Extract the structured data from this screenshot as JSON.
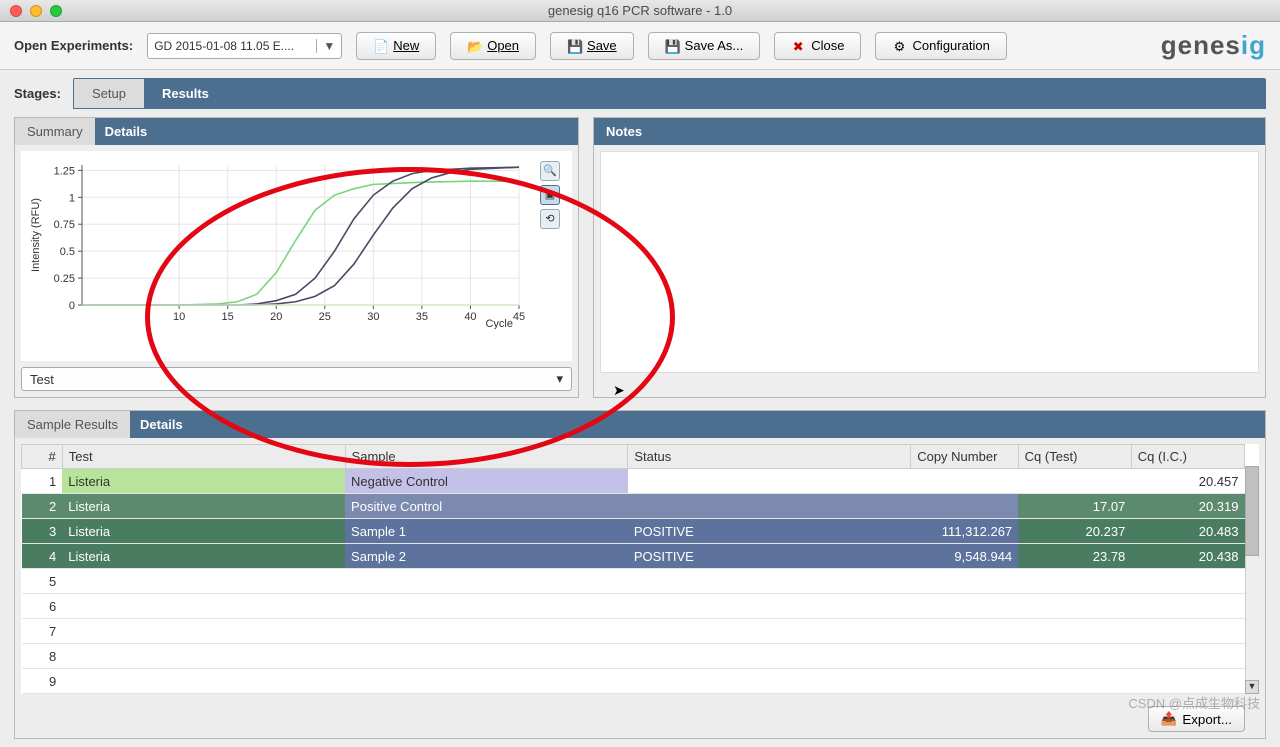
{
  "window": {
    "title": "genesig q16 PCR software - 1.0"
  },
  "toolbar": {
    "open_experiments_label": "Open Experiments:",
    "experiment_selected": "GD 2015-01-08 11.05 E....",
    "new_label": "New",
    "open_label": "Open",
    "save_label": "Save",
    "save_as_label": "Save As...",
    "close_label": "Close",
    "configuration_label": "Configuration",
    "logo_part1": "genes",
    "logo_part2": "ig"
  },
  "stages": {
    "label": "Stages:",
    "setup_tab": "Setup",
    "results_tab": "Results"
  },
  "chart_panel": {
    "summary_tab": "Summary",
    "details_tab": "Details",
    "test_select": "Test"
  },
  "notes_panel": {
    "title": "Notes"
  },
  "chart_data": {
    "type": "line",
    "title": "",
    "xlabel": "Cycle",
    "ylabel": "Intensity (RFU)",
    "xlim": [
      0,
      45
    ],
    "ylim": [
      0,
      1.3
    ],
    "xticks": [
      10,
      15,
      20,
      25,
      30,
      35,
      40,
      45
    ],
    "yticks": [
      0,
      0.25,
      0.5,
      0.75,
      1,
      1.25
    ],
    "series": [
      {
        "name": "Positive Control",
        "color": "#7bd47b",
        "x": [
          0,
          5,
          10,
          14,
          16,
          18,
          20,
          22,
          24,
          26,
          28,
          30,
          35,
          40,
          45
        ],
        "y": [
          0,
          0,
          0,
          0.01,
          0.03,
          0.1,
          0.3,
          0.6,
          0.88,
          1.02,
          1.08,
          1.12,
          1.14,
          1.15,
          1.15
        ]
      },
      {
        "name": "Sample 1",
        "color": "#4a4a66",
        "x": [
          0,
          5,
          10,
          16,
          18,
          20,
          22,
          24,
          26,
          28,
          30,
          32,
          34,
          36,
          40,
          45
        ],
        "y": [
          0,
          0,
          0,
          0,
          0.01,
          0.04,
          0.1,
          0.25,
          0.5,
          0.8,
          1.02,
          1.15,
          1.22,
          1.25,
          1.27,
          1.28
        ]
      },
      {
        "name": "Sample 2",
        "color": "#4a4a66",
        "x": [
          0,
          5,
          10,
          18,
          20,
          22,
          24,
          26,
          28,
          30,
          32,
          34,
          36,
          38,
          40,
          45
        ],
        "y": [
          0,
          0,
          0,
          0,
          0.01,
          0.03,
          0.08,
          0.18,
          0.38,
          0.65,
          0.9,
          1.08,
          1.18,
          1.23,
          1.26,
          1.28
        ]
      },
      {
        "name": "Negative Control",
        "color": "#cfe8c6",
        "x": [
          0,
          10,
          20,
          30,
          40,
          45
        ],
        "y": [
          0,
          0,
          0,
          0,
          0,
          0
        ]
      }
    ]
  },
  "results": {
    "tab_sample": "Sample Results",
    "tab_details": "Details",
    "columns": {
      "num": "#",
      "test": "Test",
      "sample": "Sample",
      "status": "Status",
      "copy": "Copy Number",
      "cq_test": "Cq (Test)",
      "cq_ic": "Cq (I.C.)"
    },
    "rows": [
      {
        "num": "1",
        "test": "Listeria",
        "sample": "Negative Control",
        "status": "",
        "copy": "",
        "cq_test": "",
        "cq_ic": "20.457"
      },
      {
        "num": "2",
        "test": "Listeria",
        "sample": "Positive Control",
        "status": "",
        "copy": "",
        "cq_test": "17.07",
        "cq_ic": "20.319"
      },
      {
        "num": "3",
        "test": "Listeria",
        "sample": "Sample 1",
        "status": "POSITIVE",
        "copy": "111,312.267",
        "cq_test": "20.237",
        "cq_ic": "20.483"
      },
      {
        "num": "4",
        "test": "Listeria",
        "sample": "Sample 2",
        "status": "POSITIVE",
        "copy": "9,548.944",
        "cq_test": "23.78",
        "cq_ic": "20.438"
      },
      {
        "num": "5",
        "test": "",
        "sample": "",
        "status": "",
        "copy": "",
        "cq_test": "",
        "cq_ic": ""
      },
      {
        "num": "6",
        "test": "",
        "sample": "",
        "status": "",
        "copy": "",
        "cq_test": "",
        "cq_ic": ""
      },
      {
        "num": "7",
        "test": "",
        "sample": "",
        "status": "",
        "copy": "",
        "cq_test": "",
        "cq_ic": ""
      },
      {
        "num": "8",
        "test": "",
        "sample": "",
        "status": "",
        "copy": "",
        "cq_test": "",
        "cq_ic": ""
      },
      {
        "num": "9",
        "test": "",
        "sample": "",
        "status": "",
        "copy": "",
        "cq_test": "",
        "cq_ic": ""
      }
    ],
    "export_label": "Export..."
  },
  "watermark": "CSDN @点成生物科技"
}
